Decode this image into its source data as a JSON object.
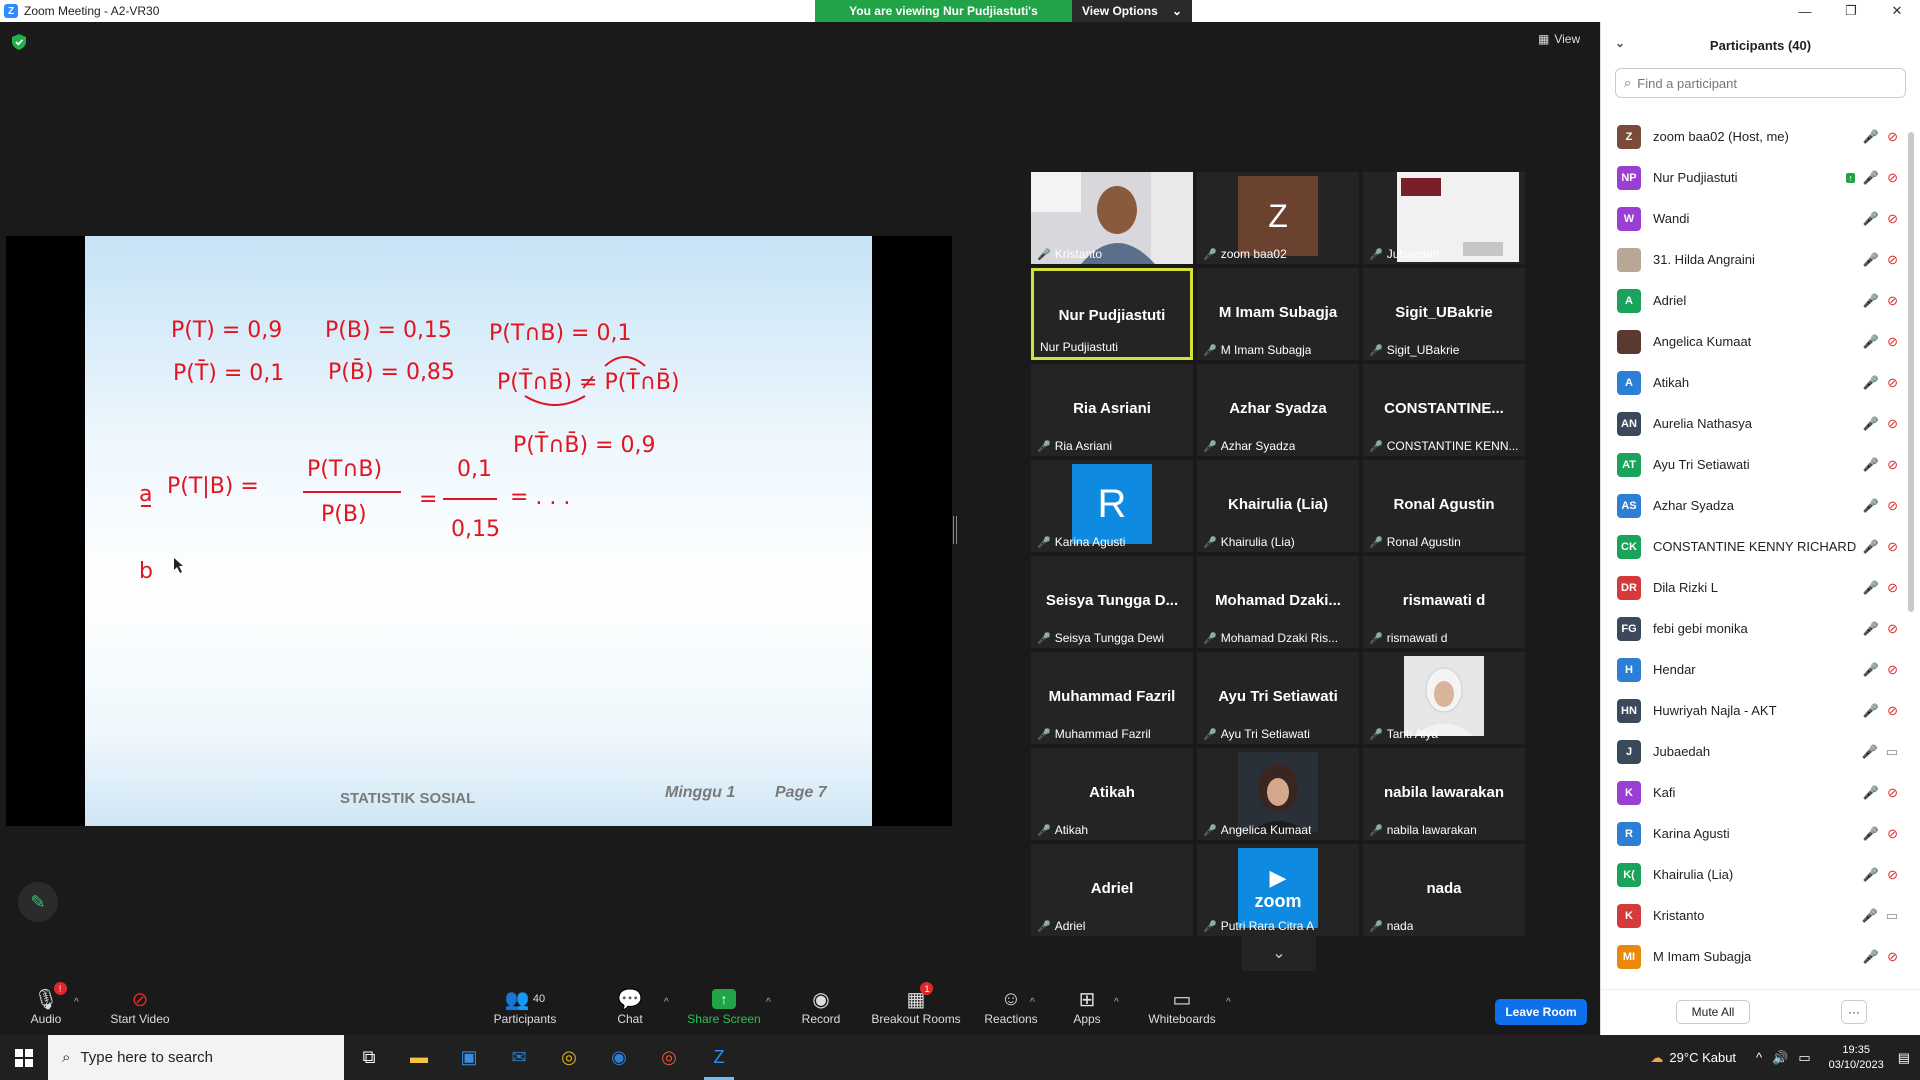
{
  "window": {
    "title": "Zoom Meeting - A2-VR30"
  },
  "banner": {
    "message": "You are viewing Nur Pudjiastuti's screen",
    "options_label": "View Options"
  },
  "stage": {
    "view_label": "View"
  },
  "slide": {
    "lines": {
      "l1a": "P(T) = 0,9",
      "l1b": "P(B) = 0,15",
      "l1c": "P(T∩B) = 0,1",
      "l2a": "P(T̄) = 0,1",
      "l2b": "P(B̄) = 0,85",
      "l2c": "P(T̄∩B̄) ≠ P(T̄∩B̄)",
      "l3": "P(T̄∩B̄) = 0,9",
      "a_label": "a",
      "a_lhs": "P(T|B) =",
      "a_num": "P(T∩B)",
      "a_den": "P(B)",
      "a_eq": "=",
      "a_num2": "0,1",
      "a_den2": "0,15",
      "a_tail": "= . . .",
      "b_label": "b"
    },
    "footer_left": "STATISTIK SOSIAL",
    "footer_week": "Minggu  1",
    "footer_page": "Page  7"
  },
  "gallery": {
    "tiles": [
      {
        "big": "",
        "label": "Kristanto"
      },
      {
        "big": "Z",
        "label": "zoom baa02"
      },
      {
        "big": "",
        "label": "Jubaedah"
      },
      {
        "big": "Nur Pudjiastuti",
        "label": "Nur Pudjiastuti"
      },
      {
        "big": "M Imam Subagja",
        "label": "M Imam Subagja"
      },
      {
        "big": "Sigit_UBakrie",
        "label": "Sigit_UBakrie"
      },
      {
        "big": "Ria Asriani",
        "label": "Ria Asriani"
      },
      {
        "big": "Azhar Syadza",
        "label": "Azhar Syadza"
      },
      {
        "big": "CONSTANTINE...",
        "label": "CONSTANTINE KENN..."
      },
      {
        "big": "R",
        "label": "Karina Agusti"
      },
      {
        "big": "Khairulia (Lia)",
        "label": "Khairulia (Lia)"
      },
      {
        "big": "Ronal Agustin",
        "label": "Ronal Agustin"
      },
      {
        "big": "Seisya Tungga D...",
        "label": "Seisya Tungga Dewi"
      },
      {
        "big": "Mohamad  Dzaki...",
        "label": "Mohamad Dzaki Ris..."
      },
      {
        "big": "rismawati d",
        "label": "rismawati d"
      },
      {
        "big": "Muhammad Fazril",
        "label": "Muhammad Fazril"
      },
      {
        "big": "Ayu Tri Setiawati",
        "label": "Ayu Tri Setiawati"
      },
      {
        "big": "",
        "label": "Tanti Alya"
      },
      {
        "big": "Atikah",
        "label": "Atikah"
      },
      {
        "big": "",
        "label": "Angelica Kumaat"
      },
      {
        "big": "nabila lawarakan",
        "label": "nabila lawarakan"
      },
      {
        "big": "Adriel",
        "label": "Adriel"
      },
      {
        "big": "zoom",
        "label": "Putri Rara Citra A"
      },
      {
        "big": "nada",
        "label": "nada"
      }
    ]
  },
  "toolbar": {
    "audio": "Audio",
    "audio_badge": "!",
    "video": "Start Video",
    "participants": "Participants",
    "participants_count": "40",
    "chat": "Chat",
    "share": "Share Screen",
    "record": "Record",
    "breakout": "Breakout Rooms",
    "breakout_badge": "1",
    "reactions": "Reactions",
    "apps": "Apps",
    "whiteboards": "Whiteboards",
    "leave": "Leave Room"
  },
  "panel": {
    "title": "Participants (40)",
    "search_placeholder": "Find a participant",
    "participants": [
      {
        "initials": "Z",
        "name": "zoom baa02 (Host, me)",
        "color": "#7a4a3a"
      },
      {
        "initials": "NP",
        "name": "Nur Pudjiastuti",
        "color": "#9b3fd4"
      },
      {
        "initials": "W",
        "name": "Wandi",
        "color": "#9b3fd4"
      },
      {
        "initials": "",
        "name": "31. Hilda Angraini",
        "color": "#b7a895"
      },
      {
        "initials": "A",
        "name": "Adriel",
        "color": "#1aa35a"
      },
      {
        "initials": "",
        "name": "Angelica Kumaat",
        "color": "#5a3a30"
      },
      {
        "initials": "A",
        "name": "Atikah",
        "color": "#2d7fd6"
      },
      {
        "initials": "AN",
        "name": "Aurelia Nathasya",
        "color": "#3a4a5a"
      },
      {
        "initials": "AT",
        "name": "Ayu Tri Setiawati",
        "color": "#1aa35a"
      },
      {
        "initials": "AS",
        "name": "Azhar Syadza",
        "color": "#2d7fd6"
      },
      {
        "initials": "CK",
        "name": "CONSTANTINE KENNY RICHARD",
        "color": "#1aa35a"
      },
      {
        "initials": "DR",
        "name": "Dila Rizki L",
        "color": "#d43a3a"
      },
      {
        "initials": "FG",
        "name": "febi gebi monika",
        "color": "#3a4a5a"
      },
      {
        "initials": "H",
        "name": "Hendar",
        "color": "#2d7fd6"
      },
      {
        "initials": "HN",
        "name": "Huwriyah Najla - AKT",
        "color": "#3a4a5a"
      },
      {
        "initials": "J",
        "name": "Jubaedah",
        "color": "#3a4a5a"
      },
      {
        "initials": "K",
        "name": "Kafi",
        "color": "#9b3fd4"
      },
      {
        "initials": "R",
        "name": "Karina Agusti",
        "color": "#2d7fd6"
      },
      {
        "initials": "K(",
        "name": "Khairulia (Lia)",
        "color": "#1aa35a"
      },
      {
        "initials": "K",
        "name": "Kristanto",
        "color": "#d43a3a"
      },
      {
        "initials": "MI",
        "name": "M Imam Subagja",
        "color": "#e8890c"
      },
      {
        "initials": "",
        "name": "",
        "color": "#d43a3a"
      }
    ],
    "mute_all": "Mute All",
    "more": "···"
  },
  "taskbar": {
    "search_placeholder": "Type here to search",
    "weather": "29°C  Kabut",
    "time": "19:35",
    "date": "03/10/2023"
  }
}
